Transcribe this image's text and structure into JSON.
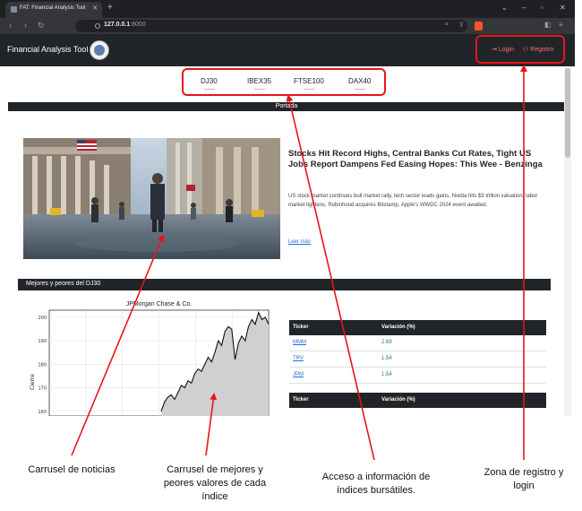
{
  "browser": {
    "tab_title": "FAT: Financial Analysis Tool",
    "url_host": "127.0.0.1",
    "url_port": ":8000"
  },
  "navbar": {
    "brand": "Financial Analysis Tool",
    "login": "Login",
    "register": "Registro"
  },
  "indices": [
    "DJ30",
    "IBEX35",
    "FTSE100",
    "DAX40"
  ],
  "portada": "Portada",
  "news": {
    "title": "Stocks Hit Record Highs, Central Banks Cut Rates, Tight US Jobs Report Dampens Fed Easing Hopes: This Wee - Benzinga",
    "summary": "US stock market continues bull market rally, tech sector leads gains, Nvidia hits $3 trillion valuation, labor market tightens, Robinhood acquires Bitstamp, Apple's WWDC 2024 event awaited.",
    "link": "Leer más"
  },
  "movers": {
    "heading": "Mejores y peores del DJ30"
  },
  "chart_data": {
    "type": "area",
    "title": "JPMorgan Chase & Co.",
    "ylabel": "Cierre",
    "xlabel": "",
    "yticks": [
      200,
      190,
      180,
      170,
      160
    ],
    "ylim": [
      158,
      203
    ],
    "grid": true,
    "x": [
      0,
      1,
      2,
      3,
      4,
      5,
      6,
      7,
      8,
      9,
      10,
      11,
      12,
      13,
      14,
      15,
      16,
      17,
      18,
      19,
      20,
      21,
      22,
      23,
      24,
      25,
      26,
      27,
      28,
      29,
      30,
      31,
      32
    ],
    "y": [
      160,
      164,
      166,
      167,
      165,
      168,
      171,
      170,
      173,
      172,
      176,
      178,
      177,
      180,
      183,
      181,
      185,
      190,
      188,
      194,
      196,
      195,
      182,
      189,
      192,
      190,
      196,
      199,
      197,
      202,
      199,
      200,
      197
    ]
  },
  "best_table": {
    "headers": [
      "Ticker",
      "Variación (%)"
    ],
    "rows": [
      {
        "ticker": "MMM",
        "change": "2.69"
      },
      {
        "ticker": "TRV",
        "change": "1.54"
      },
      {
        "ticker": "JPM",
        "change": "1.54"
      }
    ]
  },
  "worst_table": {
    "headers": [
      "Ticker",
      "Variación (%)"
    ]
  },
  "annotations": {
    "news": "Carrusel de noticias",
    "movers_1": "Carrusel de mejores y",
    "movers_2": "peores valores de cada",
    "movers_3": "índice",
    "indices_1": "Acceso a información de",
    "indices_2": "índices bursátiles.",
    "auth_1": "Zona de registro y",
    "auth_2": "login"
  },
  "colors": {
    "annotation": "#e8141b",
    "navbar": "#212529",
    "positive": "#1e8a3a"
  }
}
